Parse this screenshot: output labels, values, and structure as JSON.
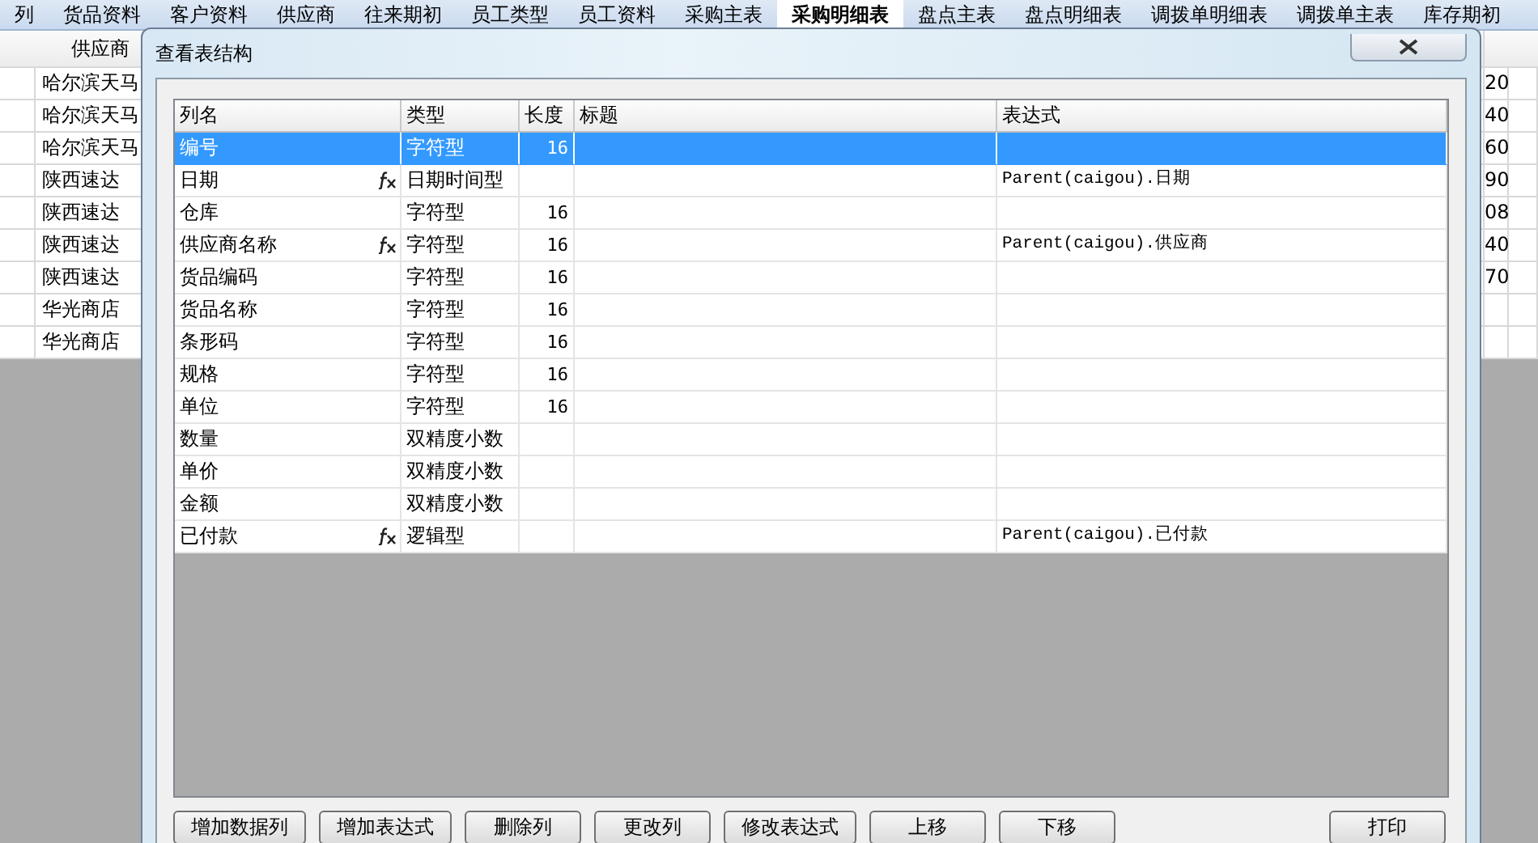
{
  "tabs": [
    {
      "label": "列",
      "selected": false
    },
    {
      "label": "货品资料",
      "selected": false
    },
    {
      "label": "客户资料",
      "selected": false
    },
    {
      "label": "供应商",
      "selected": false
    },
    {
      "label": "往来期初",
      "selected": false
    },
    {
      "label": "员工类型",
      "selected": false
    },
    {
      "label": "员工资料",
      "selected": false
    },
    {
      "label": "采购主表",
      "selected": false
    },
    {
      "label": "采购明细表",
      "selected": true
    },
    {
      "label": "盘点主表",
      "selected": false
    },
    {
      "label": "盘点明细表",
      "selected": false
    },
    {
      "label": "调拨单明细表",
      "selected": false
    },
    {
      "label": "调拨单主表",
      "selected": false
    },
    {
      "label": "库存期初",
      "selected": false
    }
  ],
  "background_table": {
    "column_1": "供应商",
    "rows": [
      {
        "column_1": "哈尔滨天马",
        "column_2": "20"
      },
      {
        "column_1": "哈尔滨天马",
        "column_2": "40"
      },
      {
        "column_1": "哈尔滨天马",
        "column_2": "60"
      },
      {
        "column_1": "陕西速达",
        "column_2": "90"
      },
      {
        "column_1": "陕西速达",
        "column_2": "08"
      },
      {
        "column_1": "陕西速达",
        "column_2": "40"
      },
      {
        "column_1": "陕西速达",
        "column_2": "70"
      },
      {
        "column_1": "华光商店"
      },
      {
        "column_1": "华光商店"
      }
    ]
  },
  "dialog": {
    "title": "查看表结构",
    "table": {
      "columns": [
        "列名",
        "类型",
        "长度",
        "标题",
        "表达式"
      ],
      "rows": [
        {
          "name": "编号",
          "computed": false,
          "type": "字符型",
          "length": "16",
          "expression": "",
          "selected": true
        },
        {
          "name": "日期",
          "computed": true,
          "type": "日期时间型",
          "length": "",
          "expression": "Parent(caigou).日期",
          "selected": false
        },
        {
          "name": "仓库",
          "computed": false,
          "type": "字符型",
          "length": "16",
          "expression": "",
          "selected": false
        },
        {
          "name": "供应商名称",
          "computed": true,
          "type": "字符型",
          "length": "16",
          "expression": "Parent(caigou).供应商",
          "selected": false
        },
        {
          "name": "货品编码",
          "computed": false,
          "type": "字符型",
          "length": "16",
          "expression": "",
          "selected": false
        },
        {
          "name": "货品名称",
          "computed": false,
          "type": "字符型",
          "length": "16",
          "expression": "",
          "selected": false
        },
        {
          "name": "条形码",
          "computed": false,
          "type": "字符型",
          "length": "16",
          "expression": "",
          "selected": false
        },
        {
          "name": "规格",
          "computed": false,
          "type": "字符型",
          "length": "16",
          "expression": "",
          "selected": false
        },
        {
          "name": "单位",
          "computed": false,
          "type": "字符型",
          "length": "16",
          "expression": "",
          "selected": false
        },
        {
          "name": "数量",
          "computed": false,
          "type": "双精度小数",
          "length": "",
          "expression": "",
          "selected": false
        },
        {
          "name": "单价",
          "computed": false,
          "type": "双精度小数",
          "length": "",
          "expression": "",
          "selected": false
        },
        {
          "name": "金额",
          "computed": false,
          "type": "双精度小数",
          "length": "",
          "expression": "",
          "selected": false
        },
        {
          "name": "已付款",
          "computed": true,
          "type": "逻辑型",
          "length": "",
          "expression": "Parent(caigou).已付款",
          "selected": false
        }
      ]
    },
    "buttons": [
      {
        "label": "增加数据列",
        "kind": "left"
      },
      {
        "label": "增加表达式",
        "kind": "left"
      },
      {
        "label": "删除列",
        "kind": "left"
      },
      {
        "label": "更改列",
        "kind": "left"
      },
      {
        "label": "修改表达式",
        "kind": "left"
      },
      {
        "label": "上移",
        "kind": "left"
      },
      {
        "label": "下移",
        "kind": "left"
      },
      {
        "label": "打印",
        "kind": "right"
      }
    ]
  }
}
